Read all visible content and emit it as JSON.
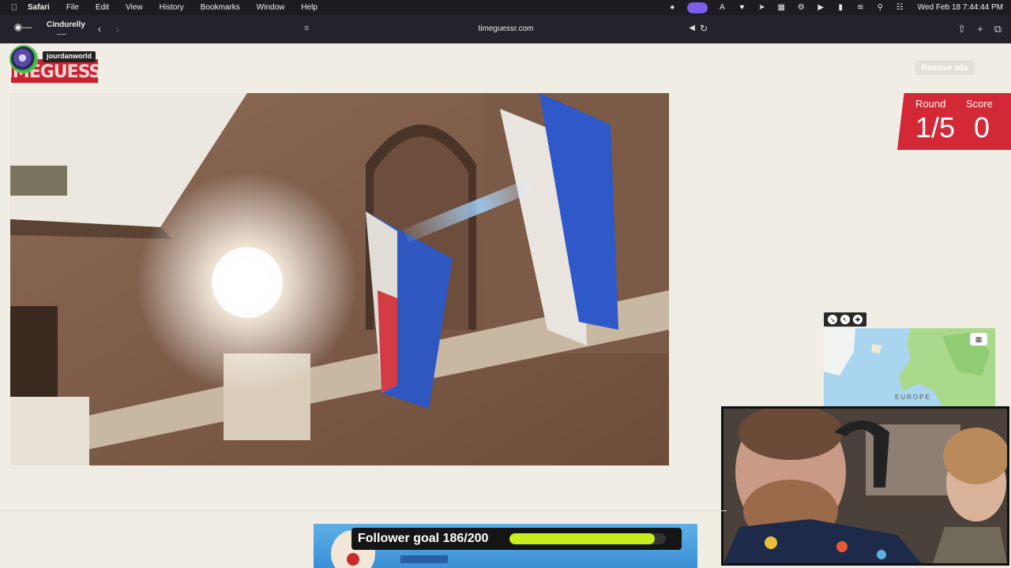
{
  "menubar": {
    "app_name": "Safari",
    "items": [
      "File",
      "Edit",
      "View",
      "History",
      "Bookmarks",
      "Window",
      "Help"
    ],
    "clock": "Wed Feb 18  7:44:44 PM"
  },
  "toolbar": {
    "profile_name": "Cindurelly",
    "url": "timeguessr.com"
  },
  "page": {
    "logo_text": "TIMEGUESSR",
    "username": "jourdanworld",
    "remove_ads_label": "Remove ads",
    "round_label": "Round",
    "round_value": "1/5",
    "score_label": "Score",
    "score_value": "0",
    "map_region_label": "EUROPE"
  },
  "overlay": {
    "follower_goal_text": "Follower goal 186/200",
    "follower_current": 186,
    "follower_target": 200
  },
  "colors": {
    "accent_red": "#d32836",
    "goal_bar": "#c7ef1d"
  }
}
